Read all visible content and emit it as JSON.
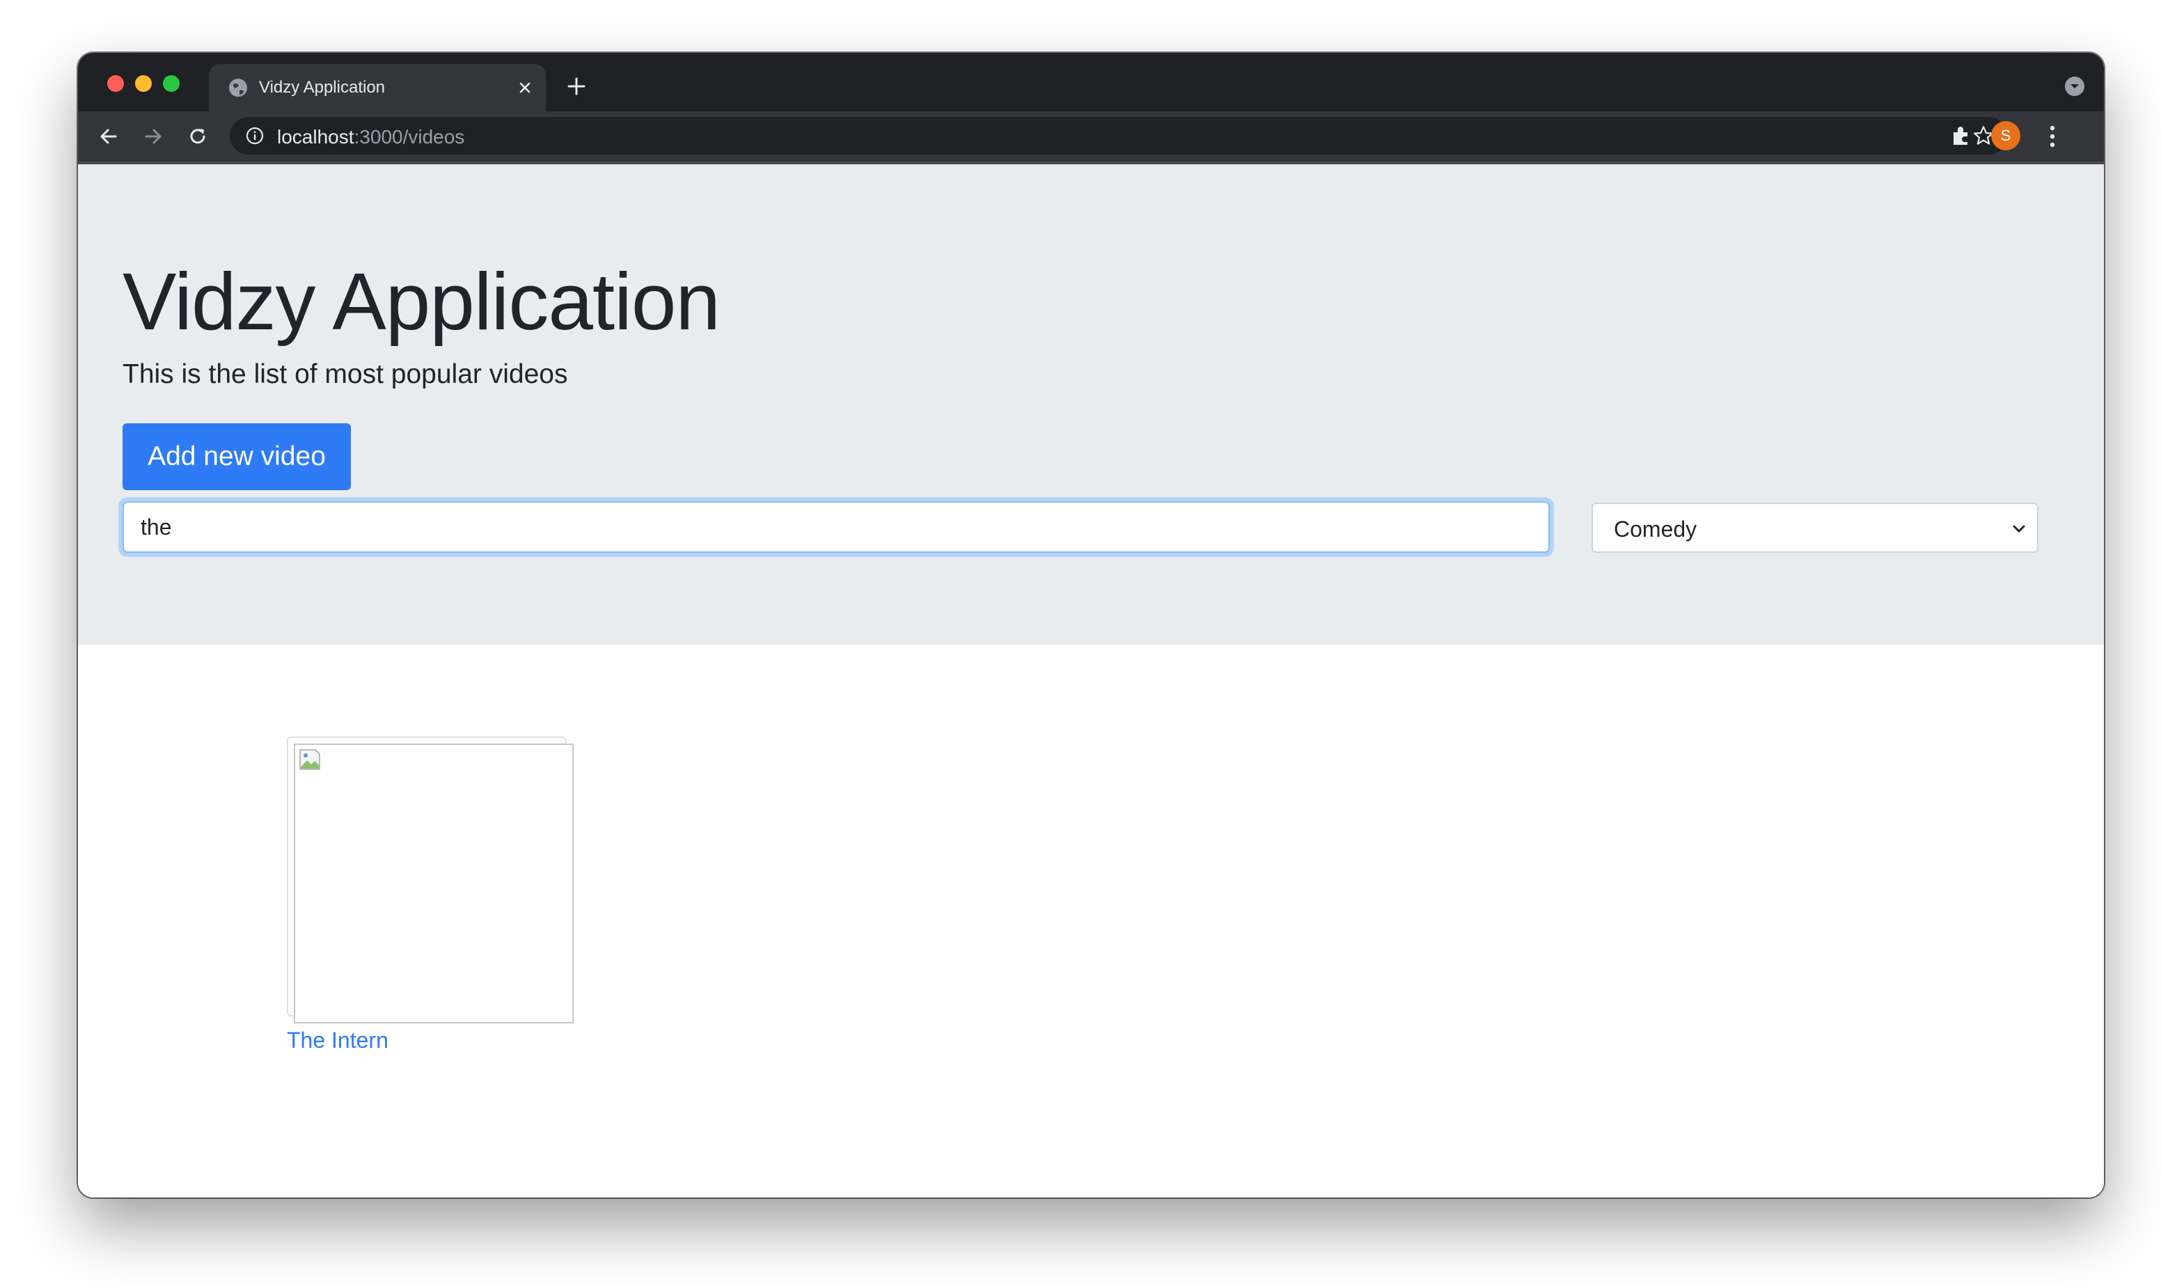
{
  "browser": {
    "tab_title": "Vidzy Application",
    "url_host": "localhost",
    "url_path": ":3000/videos",
    "profile_initial": "S"
  },
  "page": {
    "title": "Vidzy Application",
    "subtitle": "This is the list of most popular videos",
    "add_button_label": "Add new video",
    "search_value": "the",
    "genre_selected": "Comedy"
  },
  "videos": [
    {
      "title": "The Intern"
    }
  ],
  "colors": {
    "primary": "#2f7bf5",
    "jumbotron_bg": "#e9ecef",
    "browser_frame": "#202124",
    "avatar": "#e8711c"
  },
  "icons": [
    "globe-icon",
    "close-icon",
    "plus-icon",
    "back-icon",
    "forward-icon",
    "reload-icon",
    "info-icon",
    "star-icon",
    "extensions-icon",
    "more-icon",
    "chevron-down-icon",
    "broken-image-icon"
  ]
}
